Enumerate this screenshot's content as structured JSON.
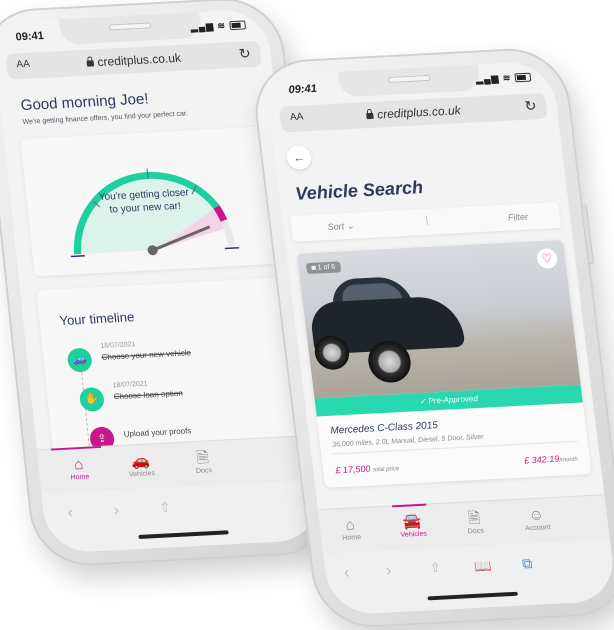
{
  "left_phone": {
    "status": {
      "time": "09:41",
      "signal_icon": "signal-icon",
      "wifi_icon": "wifi-icon",
      "battery_icon": "battery-icon"
    },
    "browser": {
      "text_size_label": "AA",
      "url": "creditplus.co.uk",
      "lock_icon": "lock-icon",
      "reload_icon": "reload-icon"
    },
    "greeting": "Good morning Joe!",
    "subtitle": "We're getting finance offers, you find your perfect car.",
    "gauge": {
      "message_line1": "You're getting closer",
      "message_line2": "to your new car!",
      "progress": 0.88,
      "colors": {
        "track": "#1fcf9f",
        "fill": "#dcf3ec",
        "marker": "#c8178a",
        "needle": "#666666"
      }
    },
    "timeline": {
      "title": "Your timeline",
      "items": [
        {
          "date": "18/07/2021",
          "label": "Choose your new vehicle",
          "done": true,
          "icon": "car-icon",
          "color": "#1fcf9f"
        },
        {
          "date": "18/07/2021",
          "label": "Choose loan option",
          "done": true,
          "icon": "hand-coin-icon",
          "color": "#1fcf9f"
        },
        {
          "date": "",
          "label": "Upload your proofs",
          "done": false,
          "icon": "upload-icon",
          "color": "#c8178a"
        }
      ]
    },
    "tabs": [
      {
        "label": "Home",
        "icon": "home-icon",
        "active": true
      },
      {
        "label": "Vehicles",
        "icon": "car-icon",
        "active": false
      },
      {
        "label": "Docs",
        "icon": "document-icon",
        "active": false
      }
    ],
    "browser_toolbar": [
      "back-icon",
      "forward-icon",
      "share-icon"
    ]
  },
  "right_phone": {
    "status": {
      "time": "09:41"
    },
    "browser": {
      "text_size_label": "AA",
      "url": "creditplus.co.uk"
    },
    "back_icon": "arrow-left-icon",
    "title": "Vehicle Search",
    "sort_label": "Sort",
    "separator": "|",
    "filter_label": "Filter",
    "vehicle": {
      "photo_counter": "1 of 6",
      "badge": "Pre-Approved",
      "name": "Mercedes C-Class 2015",
      "specs": "36,000 miles, 2.0L Manual, Diesel, 5 Door, Silver",
      "total_price": "£ 17,500",
      "total_price_label": "total price",
      "monthly_price": "£ 342.19",
      "monthly_label": "/month"
    },
    "tabs": [
      {
        "label": "Home",
        "icon": "home-icon",
        "active": false
      },
      {
        "label": "Vehicles",
        "icon": "car-icon",
        "active": true
      },
      {
        "label": "Docs",
        "icon": "document-icon",
        "active": false
      },
      {
        "label": "Account",
        "icon": "user-icon",
        "active": false
      }
    ],
    "browser_toolbar": [
      "back-icon",
      "forward-icon",
      "share-icon",
      "bookmarks-icon",
      "tabs-icon"
    ]
  },
  "colors": {
    "brand_pink": "#c8178a",
    "brand_teal": "#2ad8b0",
    "navy_text": "#2d3a5a"
  }
}
